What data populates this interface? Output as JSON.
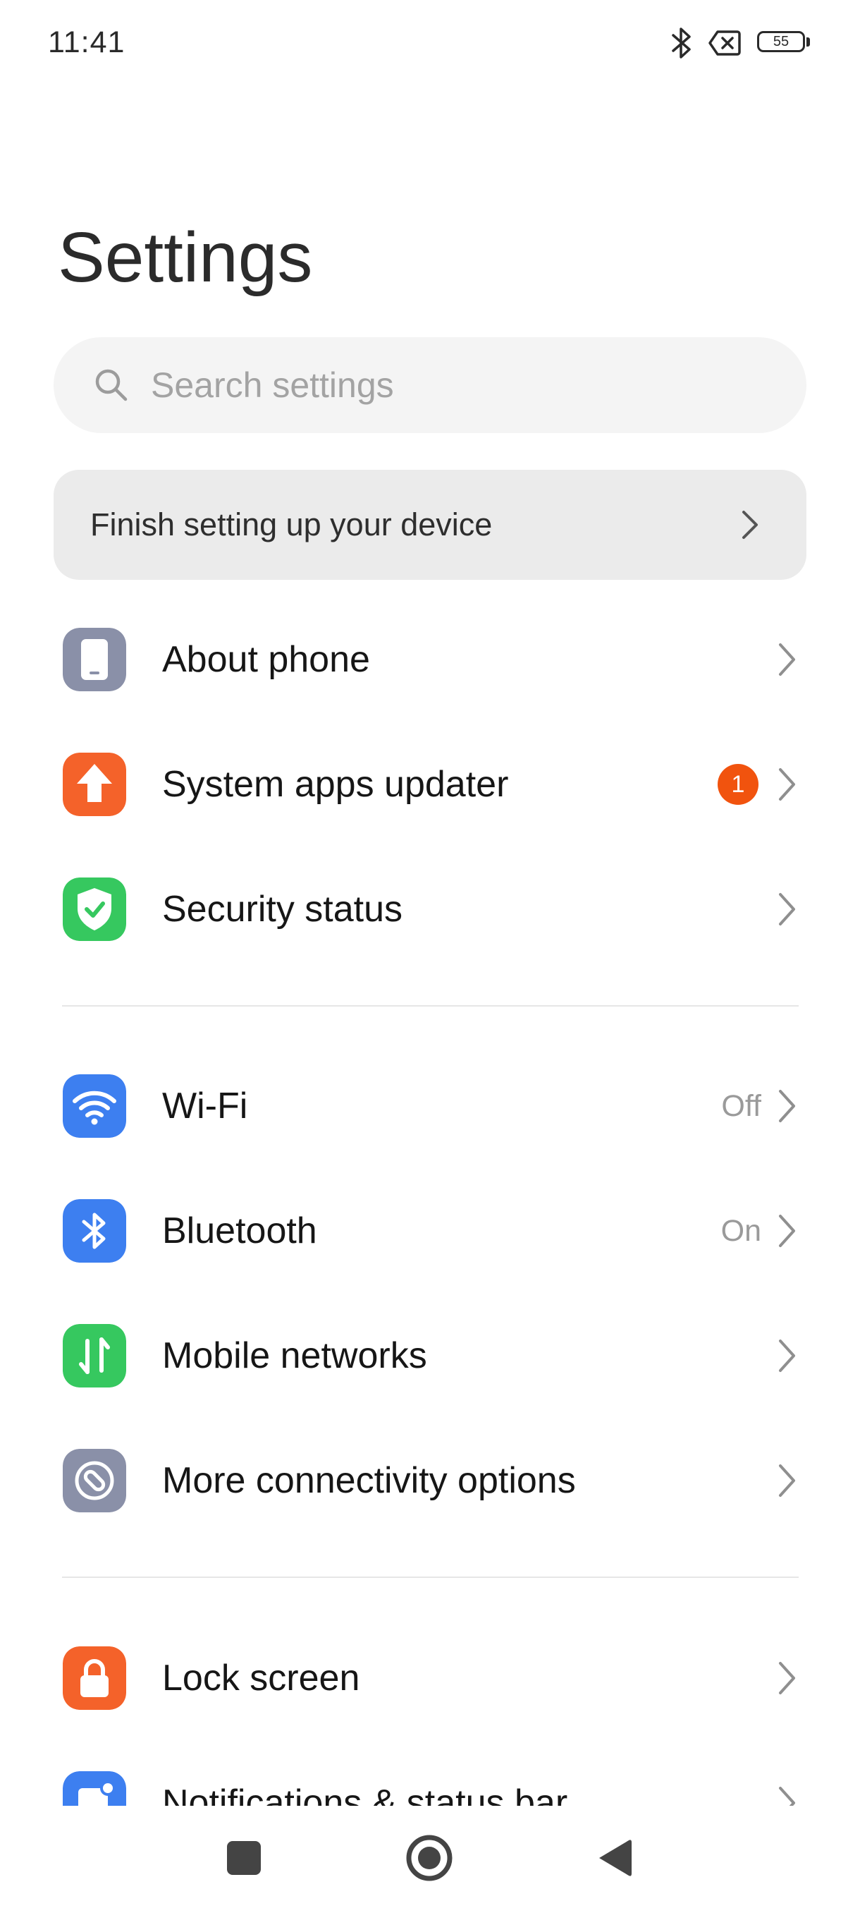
{
  "status_bar": {
    "time": "11:41",
    "battery_level": "55",
    "icons": [
      "bluetooth-icon",
      "no-sim-icon",
      "battery-icon"
    ]
  },
  "page": {
    "title": "Settings"
  },
  "search": {
    "placeholder": "Search settings",
    "value": ""
  },
  "setup_card": {
    "label": "Finish setting up your device"
  },
  "settings": {
    "about_phone": {
      "label": "About phone",
      "icon": "phone-icon",
      "color": "#8a90a8"
    },
    "system_apps_updater": {
      "label": "System apps updater",
      "icon": "upload-arrow-icon",
      "color": "#f4622a",
      "badge": "1"
    },
    "security_status": {
      "label": "Security status",
      "icon": "shield-check-icon",
      "color": "#36c85f"
    },
    "wifi": {
      "label": "Wi-Fi",
      "value": "Off",
      "icon": "wifi-icon",
      "color": "#3d7ff0"
    },
    "bluetooth": {
      "label": "Bluetooth",
      "value": "On",
      "icon": "bluetooth-icon",
      "color": "#3d7ff0"
    },
    "mobile_networks": {
      "label": "Mobile networks",
      "icon": "mobile-data-icon",
      "color": "#36c85f"
    },
    "more_connectivity": {
      "label": "More connectivity options",
      "icon": "link-icon",
      "color": "#8a90a8"
    },
    "lock_screen": {
      "label": "Lock screen",
      "icon": "lock-icon",
      "color": "#f4622a"
    },
    "notifications": {
      "label": "Notifications & status bar",
      "icon": "notification-icon",
      "color": "#3d7ff0"
    }
  },
  "nav_bar": {
    "buttons": [
      "recents-button",
      "home-button",
      "back-button"
    ]
  }
}
